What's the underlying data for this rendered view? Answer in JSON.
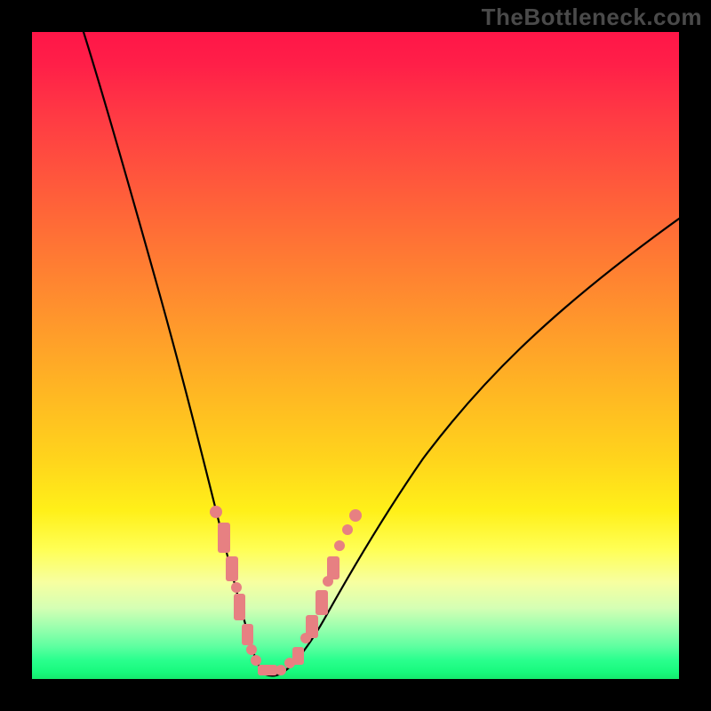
{
  "watermark": "TheBottleneck.com",
  "colors": {
    "border": "#000000",
    "curve": "#000000",
    "dots": "#e78082",
    "gradient_stops": [
      {
        "offset": 0.0,
        "color": "#ff1648"
      },
      {
        "offset": 0.05,
        "color": "#ff1f48"
      },
      {
        "offset": 0.13,
        "color": "#ff3a44"
      },
      {
        "offset": 0.28,
        "color": "#ff6638"
      },
      {
        "offset": 0.42,
        "color": "#ff8f2e"
      },
      {
        "offset": 0.54,
        "color": "#ffb224"
      },
      {
        "offset": 0.66,
        "color": "#ffd41c"
      },
      {
        "offset": 0.74,
        "color": "#fff019"
      },
      {
        "offset": 0.8,
        "color": "#ffff55"
      },
      {
        "offset": 0.85,
        "color": "#f7ffa0"
      },
      {
        "offset": 0.89,
        "color": "#d5ffb4"
      },
      {
        "offset": 0.92,
        "color": "#9bffae"
      },
      {
        "offset": 0.95,
        "color": "#5dffa0"
      },
      {
        "offset": 0.97,
        "color": "#2bff8e"
      },
      {
        "offset": 0.99,
        "color": "#17f97c"
      },
      {
        "offset": 1.0,
        "color": "#16e86c"
      }
    ]
  },
  "chart_data": {
    "type": "line",
    "title": "",
    "xlabel": "",
    "ylabel": "",
    "xlim": [
      0,
      100
    ],
    "ylim": [
      0,
      100
    ],
    "grid": false,
    "legend": false,
    "series": [
      {
        "name": "bottleneck-curve",
        "x": [
          8,
          12,
          16,
          20,
          24,
          28,
          30,
          32,
          33,
          34,
          35,
          36,
          38,
          40,
          44,
          48,
          54,
          62,
          72,
          84,
          100
        ],
        "y": [
          100,
          85,
          68,
          52,
          36,
          20,
          13,
          7,
          4,
          2,
          1,
          1,
          2,
          4,
          9,
          15,
          23,
          33,
          44,
          56,
          72
        ]
      }
    ],
    "annotations": {
      "description": "V-shaped bottleneck curve on a vertical red-to-green gradient. Pink dotted markers cluster along the lower portion of both arms near the trough.",
      "dot_clusters": [
        {
          "side": "left-arm",
          "x_range": [
            27,
            35
          ],
          "y_range": [
            2,
            25
          ]
        },
        {
          "side": "right-arm",
          "x_range": [
            35,
            46
          ],
          "y_range": [
            2,
            25
          ]
        }
      ]
    }
  }
}
